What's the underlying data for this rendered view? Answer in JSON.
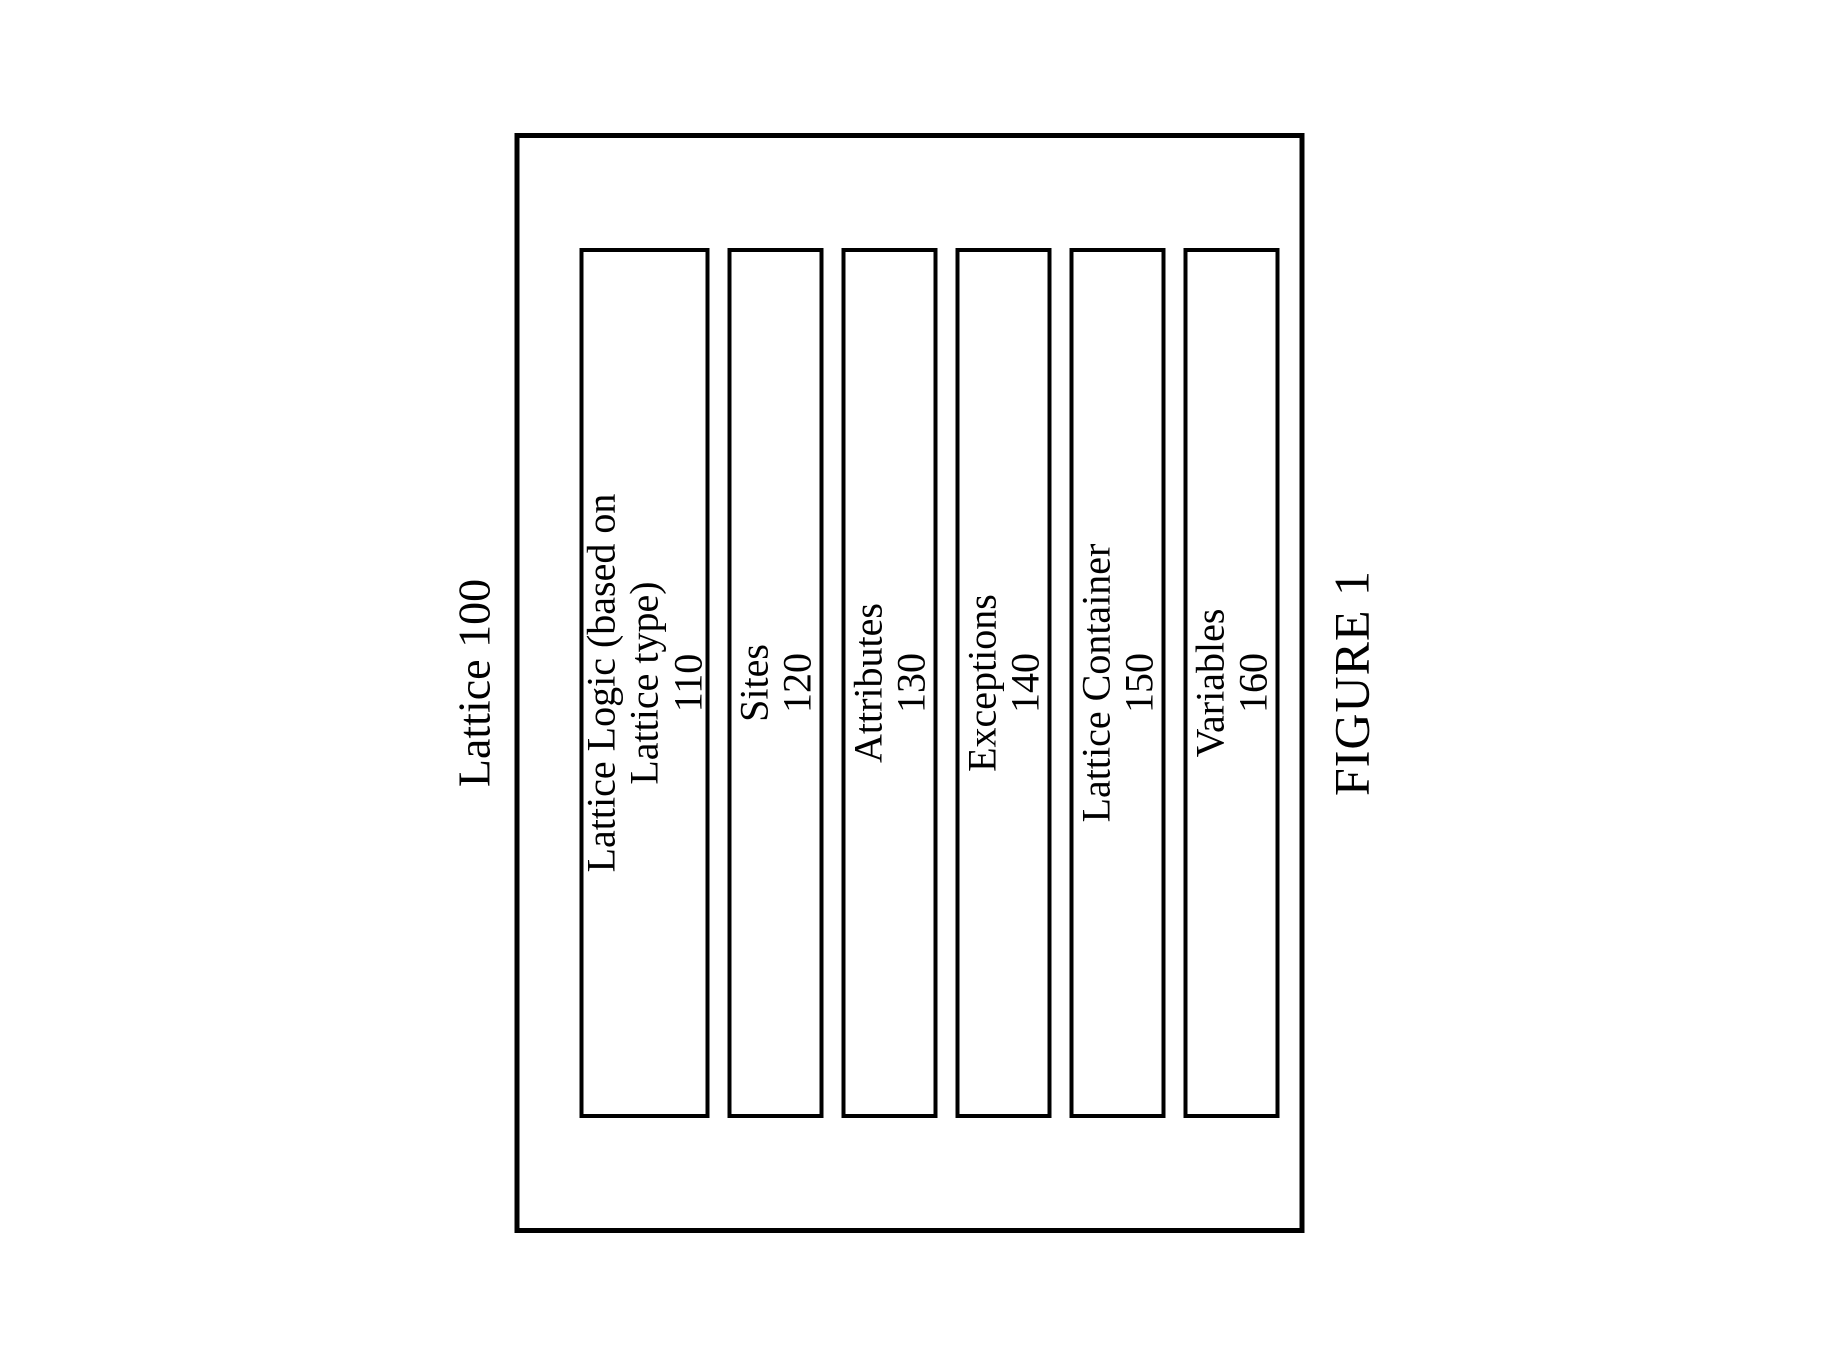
{
  "diagram": {
    "title": "Lattice 100",
    "caption": "FIGURE 1",
    "boxes": [
      {
        "label": "Lattice Logic (based on Lattice type)",
        "num": "110"
      },
      {
        "label": "Sites",
        "num": "120"
      },
      {
        "label": "Attributes",
        "num": "130"
      },
      {
        "label": "Exceptions",
        "num": "140"
      },
      {
        "label": "Lattice Container",
        "num": "150"
      },
      {
        "label": "Variables",
        "num": "160"
      }
    ]
  }
}
